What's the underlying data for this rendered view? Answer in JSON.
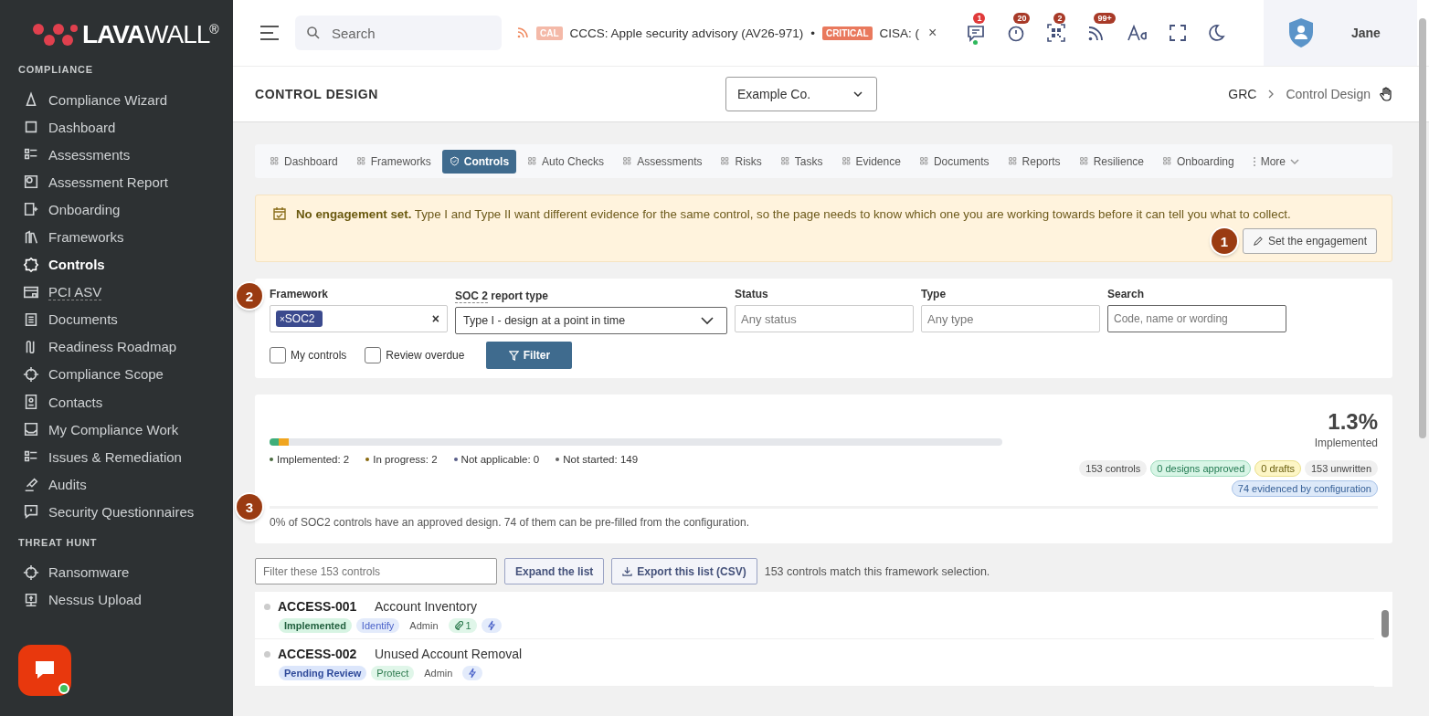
{
  "brand": {
    "name_bold": "LAVA",
    "name_light": "WALL",
    "mark": "®"
  },
  "sidebar": {
    "sections": [
      {
        "title": "COMPLIANCE",
        "items": [
          {
            "label": "Compliance Wizard",
            "selected": false
          },
          {
            "label": "Dashboard",
            "selected": false
          },
          {
            "label": "Assessments",
            "selected": false
          },
          {
            "label": "Assessment Report",
            "selected": false
          },
          {
            "label": "Onboarding",
            "selected": false
          },
          {
            "label": "Frameworks",
            "selected": false
          },
          {
            "label": "Controls",
            "selected": true
          },
          {
            "label": "PCI ASV",
            "selected": false
          },
          {
            "label": "Documents",
            "selected": false
          },
          {
            "label": "Readiness Roadmap",
            "selected": false
          },
          {
            "label": "Compliance Scope",
            "selected": false
          },
          {
            "label": "Contacts",
            "selected": false
          },
          {
            "label": "My Compliance Work",
            "selected": false
          },
          {
            "label": "Issues & Remediation",
            "selected": false
          },
          {
            "label": "Audits",
            "selected": false
          },
          {
            "label": "Security Questionnaires",
            "selected": false
          }
        ]
      },
      {
        "title": "THREAT HUNT",
        "items": [
          {
            "label": "Ransomware",
            "selected": false
          },
          {
            "label": "Nessus Upload",
            "selected": false
          }
        ]
      }
    ]
  },
  "topbar": {
    "search": {
      "placeholder": "Search"
    },
    "ticker": [
      {
        "kind": "tag",
        "text": "CAL"
      },
      {
        "kind": "text",
        "text": "CCCS: Apple security advisory (AV26-971)"
      },
      {
        "kind": "sep",
        "text": "•"
      },
      {
        "kind": "tag",
        "text": "CRITICAL"
      },
      {
        "kind": "text",
        "text": "CISA: ("
      }
    ],
    "ticker_close": "×",
    "badges": [
      "1",
      "20",
      "2",
      "99+"
    ],
    "user": "Jane"
  },
  "header": {
    "title": "CONTROL DESIGN",
    "company": "Example Co.",
    "breadcrumb": [
      "GRC",
      "Control Design"
    ]
  },
  "tabs": [
    {
      "label": "Dashboard",
      "selected": false
    },
    {
      "label": "Frameworks",
      "selected": false
    },
    {
      "label": "Controls",
      "selected": true
    },
    {
      "label": "Auto Checks",
      "selected": false
    },
    {
      "label": "Assessments",
      "selected": false
    },
    {
      "label": "Risks",
      "selected": false
    },
    {
      "label": "Tasks",
      "selected": false
    },
    {
      "label": "Evidence",
      "selected": false
    },
    {
      "label": "Documents",
      "selected": false
    },
    {
      "label": "Reports",
      "selected": false
    },
    {
      "label": "Resilience",
      "selected": false
    },
    {
      "label": "Onboarding",
      "selected": false
    },
    {
      "label": "More",
      "selected": false
    }
  ],
  "alert": {
    "text": "**No engagement set.** Type I and Type II want different evidence for the same control, so the page needs to know which one you are working towards before it can tell you what to collect.",
    "button": "Set the engagement",
    "step": "1"
  },
  "filters": {
    "step": "2",
    "framework": {
      "label": "Framework",
      "chip": "SOC2",
      "chip_remove": "×",
      "clear": "×"
    },
    "report_type": {
      "label_abbr": "SOC 2",
      "label_rest": "report type",
      "value": "Type I - design at a point in time"
    },
    "status": {
      "label": "Status",
      "placeholder": "Any status"
    },
    "type": {
      "label": "Type",
      "placeholder": "Any type"
    },
    "search": {
      "label": "Search",
      "placeholder": "Code, name or wording"
    },
    "checks": [
      {
        "label": "My controls",
        "checked": false
      },
      {
        "label": "Review overdue",
        "checked": false
      }
    ],
    "button": "Filter"
  },
  "summary": {
    "step": "3",
    "percent": "1.3%",
    "percent_label": "Implemented",
    "segments": [
      {
        "level": 0.013,
        "color": "#3fae7a"
      },
      {
        "level": 0.013,
        "color": "#f0a520"
      }
    ],
    "legend": [
      {
        "text": "Implemented: 2",
        "color": "#4a6b3f"
      },
      {
        "text": "In progress: 2",
        "color": "#8a6a10"
      },
      {
        "text": "Not applicable: 0",
        "color": "#5a5f8a"
      },
      {
        "text": "Not started: 149",
        "color": "#666666"
      }
    ],
    "chips": [
      {
        "text": "153 controls",
        "kind": "plain"
      },
      {
        "text": "0 designs approved",
        "kind": "green"
      },
      {
        "text": "0 drafts",
        "kind": "yellow"
      },
      {
        "text": "153 unwritten",
        "kind": "plain"
      },
      {
        "text": "74 evidenced by configuration",
        "kind": "blue"
      }
    ],
    "note": "0% of SOC2 controls have an approved design. 74 of them can be pre-filled from the configuration."
  },
  "list": {
    "filter_placeholder": "Filter these 153 controls",
    "expand": "Expand the list",
    "export": "Export this list (CSV)",
    "count": "153 controls match this framework selection.",
    "rows": [
      {
        "code": "ACCESS-001",
        "name": "Account Inventory",
        "tags": [
          {
            "kind": "green-strong",
            "text": "Implemented"
          },
          {
            "kind": "blue",
            "text": "Identify"
          },
          {
            "kind": "plain",
            "text": "Admin"
          },
          {
            "kind": "attach",
            "text": "1"
          },
          {
            "kind": "bolt"
          }
        ]
      },
      {
        "code": "ACCESS-002",
        "name": "Unused Account Removal",
        "tags": [
          {
            "kind": "blue-strong",
            "text": "Pending Review"
          },
          {
            "kind": "green",
            "text": "Protect"
          },
          {
            "kind": "plain",
            "text": "Admin"
          },
          {
            "kind": "bolt"
          }
        ]
      }
    ]
  }
}
